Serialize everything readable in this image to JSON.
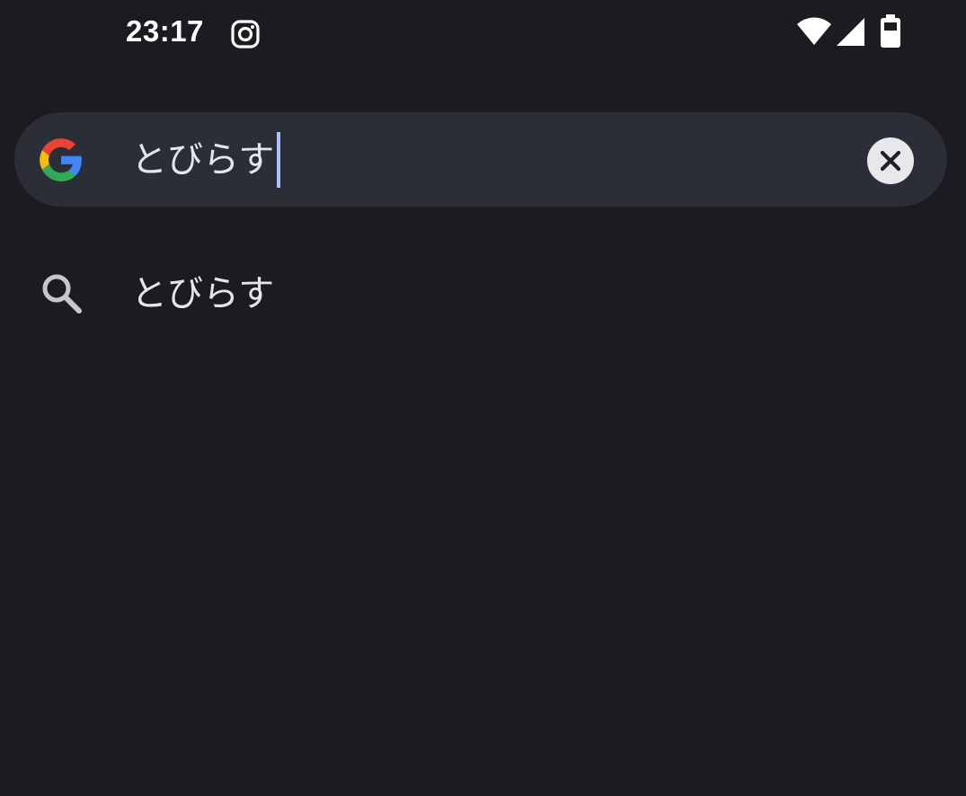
{
  "status_bar": {
    "time": "23:17",
    "notification_icons": [
      "instagram-icon"
    ],
    "system_icons": [
      "wifi-icon",
      "signal-icon",
      "battery-icon"
    ]
  },
  "search": {
    "query": "とびらす",
    "logo": "google-logo",
    "clear_icon": "close-icon"
  },
  "suggestions": [
    {
      "icon": "search-icon",
      "label": "とびらす"
    }
  ],
  "colors": {
    "background": "#1c1b20",
    "search_bar": "#2c2e37",
    "text": "#e6e6ea",
    "caret": "#a8c1ff",
    "google_blue": "#4285F4",
    "google_red": "#EA4335",
    "google_yellow": "#FBBC05",
    "google_green": "#34A853"
  }
}
